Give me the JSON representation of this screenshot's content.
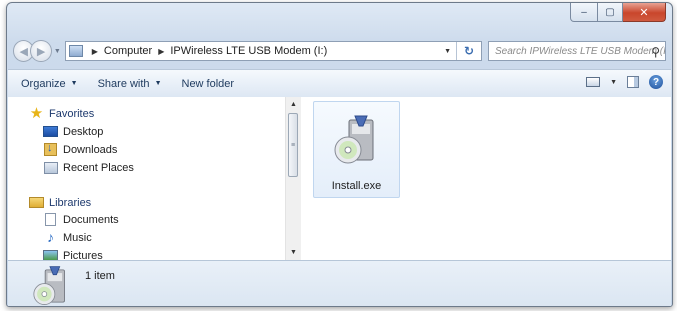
{
  "window": {
    "caption": {
      "minimize": "–",
      "maximize": "▢",
      "close": "✕"
    }
  },
  "address_bar": {
    "back_icon": "back-arrow-icon",
    "forward_icon": "forward-arrow-icon",
    "crumbs": [
      "Computer",
      "IPWireless LTE USB Modem (I:)"
    ],
    "refresh_icon": "refresh-icon"
  },
  "search": {
    "placeholder": "Search IPWireless LTE USB Modem (I:)"
  },
  "toolbar": {
    "organize": "Organize",
    "share_with": "Share with",
    "new_folder": "New folder"
  },
  "sidebar": {
    "favorites": {
      "label": "Favorites",
      "items": [
        {
          "label": "Desktop",
          "icon": "desktop-icon"
        },
        {
          "label": "Downloads",
          "icon": "downloads-icon"
        },
        {
          "label": "Recent Places",
          "icon": "recent-places-icon"
        }
      ]
    },
    "libraries": {
      "label": "Libraries",
      "items": [
        {
          "label": "Documents",
          "icon": "documents-icon"
        },
        {
          "label": "Music",
          "icon": "music-icon"
        },
        {
          "label": "Pictures",
          "icon": "pictures-icon"
        }
      ]
    }
  },
  "files": [
    {
      "name": "Install.exe",
      "icon": "installer-icon",
      "selected": true
    }
  ],
  "details": {
    "count": "1 item"
  },
  "colors": {
    "accent": "#3b6db0",
    "selection": "#e4eefa"
  }
}
